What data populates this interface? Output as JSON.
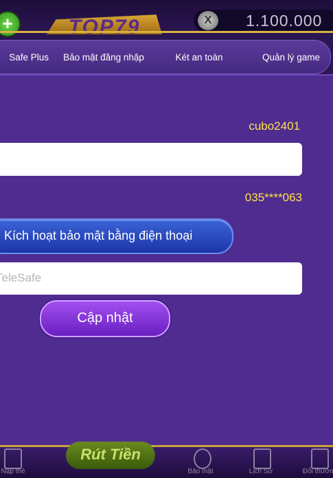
{
  "header": {
    "logo_text": "TOP79",
    "coin_icon": "X",
    "balance": "1.100.000"
  },
  "tabs": [
    {
      "label": "Safe Plus"
    },
    {
      "label": "Bảo mật đăng nhập"
    },
    {
      "label": "Két an toàn"
    },
    {
      "label": "Quản lý game"
    }
  ],
  "form": {
    "username": "cubo2401",
    "phone": "035****063",
    "activate_label": "Kích hoạt bảo mật bằng điện thoại",
    "telesafe_placeholder": "TeleSafe",
    "update_label": "Cập nhật"
  },
  "bottom_nav": {
    "item1": "Nạp thẻ",
    "promo": "Rút Tiền",
    "item3": "Bảo mật",
    "item4": "Lịch Sử",
    "item5": "Đổi thưởng"
  },
  "colors": {
    "panel": "#4f2c90",
    "accent_yellow": "#ffe14a",
    "activate_blue": "#2a4ac0",
    "update_purple": "#8a3ad8"
  }
}
